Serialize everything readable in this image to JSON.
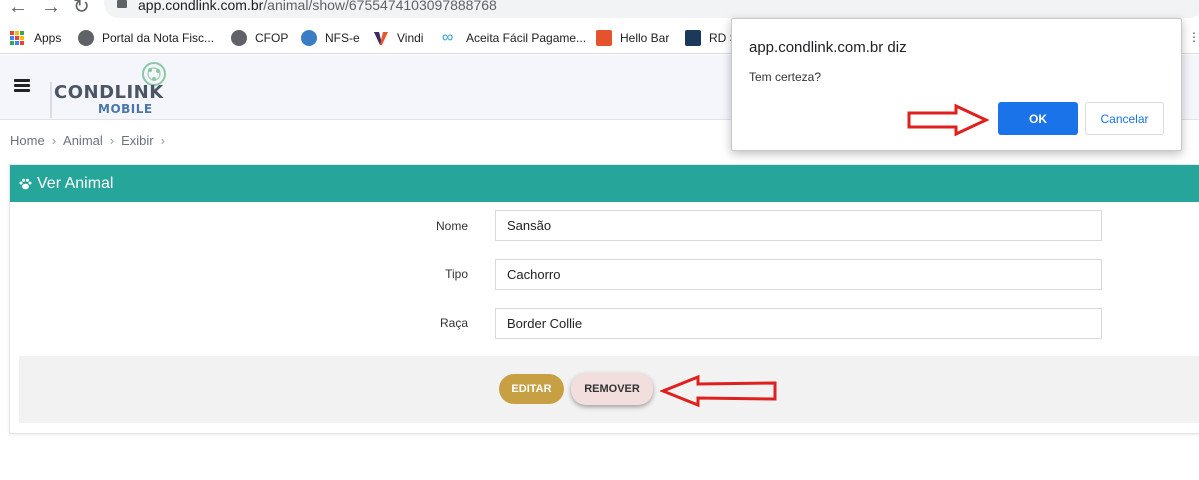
{
  "browser": {
    "url_host": "app.condlink.com.br",
    "url_path": "/animal/show/6755474103097888768",
    "bookmarks": [
      {
        "label": "Apps"
      },
      {
        "label": "Portal da Nota Fisc..."
      },
      {
        "label": "CFOP"
      },
      {
        "label": "NFS-e"
      },
      {
        "label": "Vindi"
      },
      {
        "label": "Aceita Fácil Pagame..."
      },
      {
        "label": "Hello Bar"
      },
      {
        "label": "RD S"
      }
    ]
  },
  "header": {
    "logo_text": "CONDLINK",
    "logo_sub": "MOBILE"
  },
  "breadcrumb": [
    "Home",
    "Animal",
    "Exibir"
  ],
  "panel": {
    "title": "Ver Animal",
    "fields": [
      {
        "label": "Nome",
        "value": "Sansão"
      },
      {
        "label": "Tipo",
        "value": "Cachorro"
      },
      {
        "label": "Raça",
        "value": "Border Collie"
      }
    ],
    "edit_label": "EDITAR",
    "remove_label": "REMOVER"
  },
  "dialog": {
    "title": "app.condlink.com.br diz",
    "message": "Tem certeza?",
    "ok_label": "OK",
    "cancel_label": "Cancelar"
  },
  "colors": {
    "panel_header": "#26a69a",
    "edit_button": "#c7a044",
    "remove_button": "#f3dede",
    "dialog_ok": "#1a73e8",
    "annotation_arrow": "#e0201e"
  }
}
